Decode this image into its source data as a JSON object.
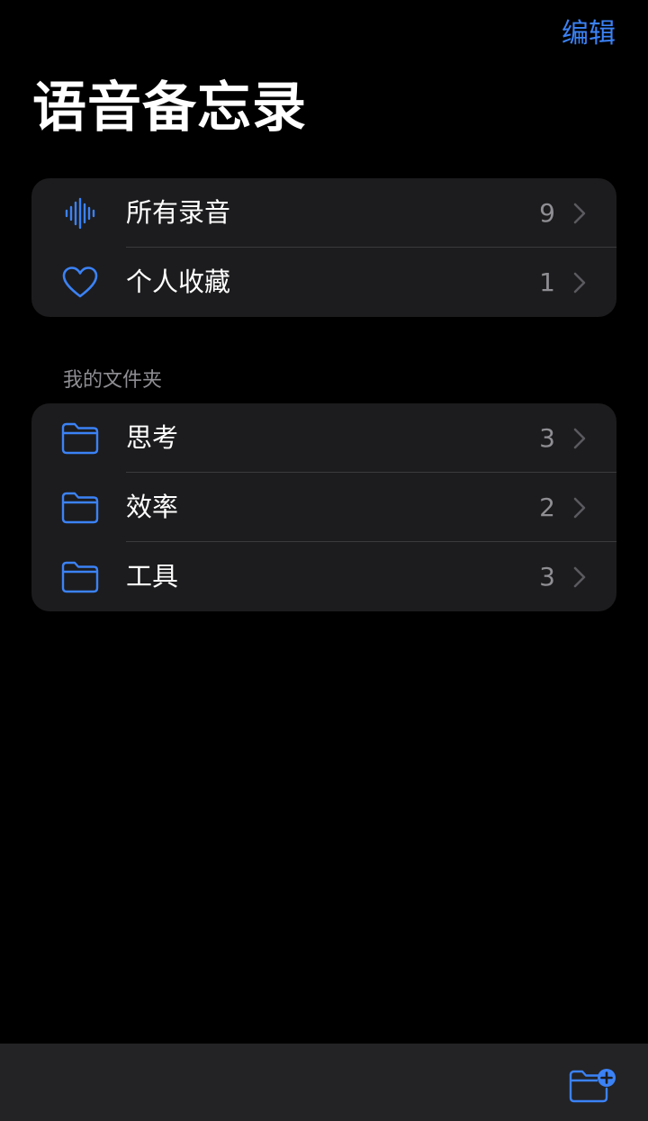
{
  "nav": {
    "edit_label": "编辑"
  },
  "title": "语音备忘录",
  "library": [
    {
      "icon": "waveform-icon",
      "label": "所有录音",
      "count": "9"
    },
    {
      "icon": "heart-icon",
      "label": "个人收藏",
      "count": "1"
    }
  ],
  "folders_header": "我的文件夹",
  "folders": [
    {
      "icon": "folder-icon",
      "label": "思考",
      "count": "3"
    },
    {
      "icon": "folder-icon",
      "label": "效率",
      "count": "2"
    },
    {
      "icon": "folder-icon",
      "label": "工具",
      "count": "3"
    }
  ],
  "toolbar": {
    "new_folder_icon": "new-folder-icon"
  },
  "colors": {
    "accent": "#3b82f6",
    "background": "#000000",
    "card": "#1c1c1e",
    "secondary_text": "#8e8e93"
  }
}
